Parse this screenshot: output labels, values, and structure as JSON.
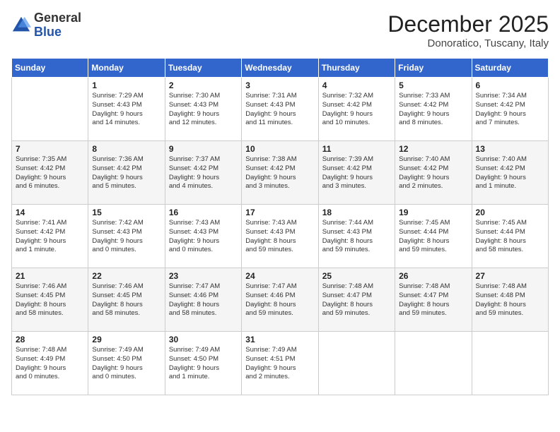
{
  "header": {
    "logo_general": "General",
    "logo_blue": "Blue",
    "month_title": "December 2025",
    "location": "Donoratico, Tuscany, Italy"
  },
  "days_of_week": [
    "Sunday",
    "Monday",
    "Tuesday",
    "Wednesday",
    "Thursday",
    "Friday",
    "Saturday"
  ],
  "weeks": [
    [
      {
        "day": "",
        "info": ""
      },
      {
        "day": "1",
        "info": "Sunrise: 7:29 AM\nSunset: 4:43 PM\nDaylight: 9 hours\nand 14 minutes."
      },
      {
        "day": "2",
        "info": "Sunrise: 7:30 AM\nSunset: 4:43 PM\nDaylight: 9 hours\nand 12 minutes."
      },
      {
        "day": "3",
        "info": "Sunrise: 7:31 AM\nSunset: 4:43 PM\nDaylight: 9 hours\nand 11 minutes."
      },
      {
        "day": "4",
        "info": "Sunrise: 7:32 AM\nSunset: 4:42 PM\nDaylight: 9 hours\nand 10 minutes."
      },
      {
        "day": "5",
        "info": "Sunrise: 7:33 AM\nSunset: 4:42 PM\nDaylight: 9 hours\nand 8 minutes."
      },
      {
        "day": "6",
        "info": "Sunrise: 7:34 AM\nSunset: 4:42 PM\nDaylight: 9 hours\nand 7 minutes."
      }
    ],
    [
      {
        "day": "7",
        "info": "Sunrise: 7:35 AM\nSunset: 4:42 PM\nDaylight: 9 hours\nand 6 minutes."
      },
      {
        "day": "8",
        "info": "Sunrise: 7:36 AM\nSunset: 4:42 PM\nDaylight: 9 hours\nand 5 minutes."
      },
      {
        "day": "9",
        "info": "Sunrise: 7:37 AM\nSunset: 4:42 PM\nDaylight: 9 hours\nand 4 minutes."
      },
      {
        "day": "10",
        "info": "Sunrise: 7:38 AM\nSunset: 4:42 PM\nDaylight: 9 hours\nand 3 minutes."
      },
      {
        "day": "11",
        "info": "Sunrise: 7:39 AM\nSunset: 4:42 PM\nDaylight: 9 hours\nand 3 minutes."
      },
      {
        "day": "12",
        "info": "Sunrise: 7:40 AM\nSunset: 4:42 PM\nDaylight: 9 hours\nand 2 minutes."
      },
      {
        "day": "13",
        "info": "Sunrise: 7:40 AM\nSunset: 4:42 PM\nDaylight: 9 hours\nand 1 minute."
      }
    ],
    [
      {
        "day": "14",
        "info": "Sunrise: 7:41 AM\nSunset: 4:42 PM\nDaylight: 9 hours\nand 1 minute."
      },
      {
        "day": "15",
        "info": "Sunrise: 7:42 AM\nSunset: 4:43 PM\nDaylight: 9 hours\nand 0 minutes."
      },
      {
        "day": "16",
        "info": "Sunrise: 7:43 AM\nSunset: 4:43 PM\nDaylight: 9 hours\nand 0 minutes."
      },
      {
        "day": "17",
        "info": "Sunrise: 7:43 AM\nSunset: 4:43 PM\nDaylight: 8 hours\nand 59 minutes."
      },
      {
        "day": "18",
        "info": "Sunrise: 7:44 AM\nSunset: 4:43 PM\nDaylight: 8 hours\nand 59 minutes."
      },
      {
        "day": "19",
        "info": "Sunrise: 7:45 AM\nSunset: 4:44 PM\nDaylight: 8 hours\nand 59 minutes."
      },
      {
        "day": "20",
        "info": "Sunrise: 7:45 AM\nSunset: 4:44 PM\nDaylight: 8 hours\nand 58 minutes."
      }
    ],
    [
      {
        "day": "21",
        "info": "Sunrise: 7:46 AM\nSunset: 4:45 PM\nDaylight: 8 hours\nand 58 minutes."
      },
      {
        "day": "22",
        "info": "Sunrise: 7:46 AM\nSunset: 4:45 PM\nDaylight: 8 hours\nand 58 minutes."
      },
      {
        "day": "23",
        "info": "Sunrise: 7:47 AM\nSunset: 4:46 PM\nDaylight: 8 hours\nand 58 minutes."
      },
      {
        "day": "24",
        "info": "Sunrise: 7:47 AM\nSunset: 4:46 PM\nDaylight: 8 hours\nand 59 minutes."
      },
      {
        "day": "25",
        "info": "Sunrise: 7:48 AM\nSunset: 4:47 PM\nDaylight: 8 hours\nand 59 minutes."
      },
      {
        "day": "26",
        "info": "Sunrise: 7:48 AM\nSunset: 4:47 PM\nDaylight: 8 hours\nand 59 minutes."
      },
      {
        "day": "27",
        "info": "Sunrise: 7:48 AM\nSunset: 4:48 PM\nDaylight: 8 hours\nand 59 minutes."
      }
    ],
    [
      {
        "day": "28",
        "info": "Sunrise: 7:48 AM\nSunset: 4:49 PM\nDaylight: 9 hours\nand 0 minutes."
      },
      {
        "day": "29",
        "info": "Sunrise: 7:49 AM\nSunset: 4:50 PM\nDaylight: 9 hours\nand 0 minutes."
      },
      {
        "day": "30",
        "info": "Sunrise: 7:49 AM\nSunset: 4:50 PM\nDaylight: 9 hours\nand 1 minute."
      },
      {
        "day": "31",
        "info": "Sunrise: 7:49 AM\nSunset: 4:51 PM\nDaylight: 9 hours\nand 2 minutes."
      },
      {
        "day": "",
        "info": ""
      },
      {
        "day": "",
        "info": ""
      },
      {
        "day": "",
        "info": ""
      }
    ]
  ]
}
